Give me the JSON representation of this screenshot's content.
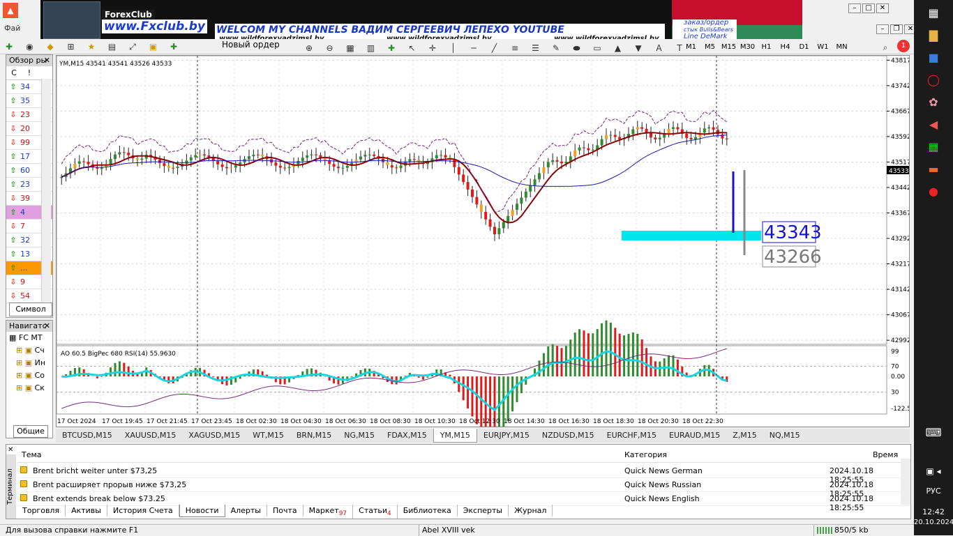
{
  "banner": {
    "forex_logo": "ForexClub",
    "forex_url": "www.Fxclub.by",
    "welcome": "WELCOM MY CHANNELS ВАДИМ СЕРГЕЕВИЧ ЛЕПЕХО YOUTUBE",
    "url1": "www.wildforexvadzimsl.by",
    "url2": "www.wildforexvadzimsl.by",
    "url3": "www.wildforexvadzimsl.by",
    "orders_line1": "заказ/ордер",
    "orders_line2": "стык Bulls&Bears",
    "orders_line3": "Line DeMark"
  },
  "menu": {
    "file_partial": "Фай"
  },
  "toolbar": {
    "new_order": "Новый ордер"
  },
  "timeframes": [
    "M1",
    "M5",
    "M15",
    "M30",
    "H1",
    "H4",
    "D1",
    "W1",
    "MN"
  ],
  "market_watch": {
    "title": "Обзор ры",
    "col1": "С",
    "col2": "!",
    "rows": [
      {
        "dir": "up",
        "value": "34"
      },
      {
        "dir": "up",
        "value": "35"
      },
      {
        "dir": "down",
        "value": "23"
      },
      {
        "dir": "down",
        "value": "20"
      },
      {
        "dir": "down",
        "value": "99"
      },
      {
        "dir": "up",
        "value": "17"
      },
      {
        "dir": "up",
        "value": "60"
      },
      {
        "dir": "up",
        "value": "23"
      },
      {
        "dir": "down",
        "value": "39"
      },
      {
        "dir": "up",
        "value": "4"
      },
      {
        "dir": "down",
        "value": "7"
      },
      {
        "dir": "up",
        "value": "32"
      },
      {
        "dir": "up",
        "value": "13"
      },
      {
        "dir": "up",
        "value": "..."
      },
      {
        "dir": "down",
        "value": "9"
      },
      {
        "dir": "down",
        "value": "54"
      }
    ],
    "tab_symbols": "Символ"
  },
  "navigator": {
    "title": "Навигатс",
    "root": "FC MT",
    "items": [
      "Сч",
      "Ин",
      "Со",
      "Ск"
    ],
    "tab_common": "Общие"
  },
  "chart": {
    "header": "YM,M15  43541 43541 43526 43533",
    "price_current": "43533",
    "price_label_blue": "43343",
    "price_label_gray": "43266",
    "y_ticks": [
      "43817",
      "43742",
      "43667",
      "43592",
      "43517",
      "43442",
      "43367",
      "43292",
      "43217",
      "43142",
      "43067",
      "42992"
    ],
    "x_ticks": [
      "17 Oct 2024",
      "17 Oct 19:45",
      "17 Oct 21:45",
      "17 Oct 23:45",
      "18 Oct 02:30",
      "18 Oct 04:30",
      "18 Oct 06:30",
      "18 Oct 08:30",
      "18 Oct 10:30",
      "18 Oct 12:30",
      "18 Oct 14:30",
      "18 Oct 16:30",
      "18 Oct 18:30",
      "18 Oct 20:30",
      "18 Oct 22:30"
    ],
    "sub_header": "AO 60.5  BigPec 680  RSI(14) 55.9630",
    "sub_ticks": [
      "99",
      "70",
      "0.00",
      "30",
      "-122.5"
    ]
  },
  "chart_tabs": [
    {
      "label": "BTCUSD,M15"
    },
    {
      "label": "XAUUSD,M15"
    },
    {
      "label": "XAGUSD,M15"
    },
    {
      "label": "WT,M15"
    },
    {
      "label": "BRN,M15"
    },
    {
      "label": "NG,M15"
    },
    {
      "label": "FDAX,M15"
    },
    {
      "label": "YM,M15",
      "active": true
    },
    {
      "label": "EURJPY,M15"
    },
    {
      "label": "NZDUSD,M15"
    },
    {
      "label": "EURCHF,M15"
    },
    {
      "label": "EURAUD,M15"
    },
    {
      "label": "Z,M15"
    },
    {
      "label": "NQ,M15"
    }
  ],
  "terminal": {
    "side_label": "Терминал",
    "col_topic": "Тема",
    "col_category": "Категория",
    "col_time": "Время",
    "rows": [
      {
        "topic": "Brent bricht weiter unter $73,25",
        "category": "Quick News German",
        "time": "2024.10.18 18:25:55"
      },
      {
        "topic": "Brent расширяет прорыв ниже $73,25",
        "category": "Quick News Russian",
        "time": "2024.10.18 18:25:55"
      },
      {
        "topic": "Brent extends break below $73.25",
        "category": "Quick News English",
        "time": "2024.10.18 18:25:55"
      }
    ],
    "tabs": [
      {
        "label": "Торговля"
      },
      {
        "label": "Активы"
      },
      {
        "label": "История Счета"
      },
      {
        "label": "Новости",
        "active": true
      },
      {
        "label": "Алерты"
      },
      {
        "label": "Почта"
      },
      {
        "label": "Маркет",
        "badge": "97"
      },
      {
        "label": "Статьи",
        "badge": "4"
      },
      {
        "label": "Библиотека"
      },
      {
        "label": "Эксперты"
      },
      {
        "label": "Журнал"
      }
    ]
  },
  "status": {
    "help": "Для вызова справки нажмите F1",
    "profile": "Abel XVIII vek",
    "traffic": "850/5 kb"
  },
  "taskbar": {
    "lang": "РУС",
    "time": "12:42",
    "date": "20.10.2024"
  },
  "colors": {
    "bull": "#2e8b2e",
    "bear": "#e11919",
    "ma_red": "#8b0000",
    "ma_blue": "#1a1aa0",
    "zone": "#00e5ee",
    "rsi": "#7b2a7b",
    "ao_line": "#18d6e0"
  }
}
